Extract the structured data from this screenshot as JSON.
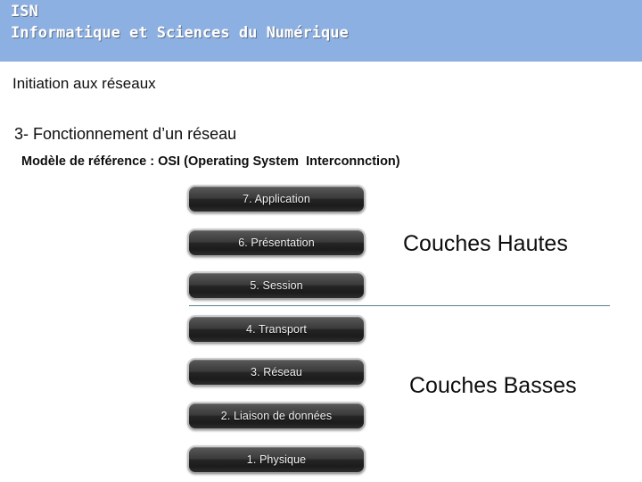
{
  "header": {
    "line1": "ISN",
    "line2": "Informatique et Sciences du Numérique",
    "background_color": "#8db0e3",
    "text_color": "#ffffff"
  },
  "content": {
    "subtitle": "Initiation aux réseaux",
    "section_title": "3- Fonctionnement d’un réseau",
    "model_line": "Modèle de référence : OSI (Operating System  Interconnction)"
  },
  "osi_stack": {
    "layers": [
      {
        "label": "7. Application"
      },
      {
        "label": "6. Présentation"
      },
      {
        "label": "5. Session"
      },
      {
        "label": "4. Transport"
      },
      {
        "label": "3. Réseau"
      },
      {
        "label": "2. Liaison de données"
      },
      {
        "label": "1. Physique"
      }
    ],
    "button_text_color": "#f2f2f2",
    "button_bevel_color": "#bdbdbd"
  },
  "groups": {
    "upper_label": "Couches Hautes",
    "lower_label": "Couches Basses",
    "divider_color": "#5b7e8f"
  }
}
